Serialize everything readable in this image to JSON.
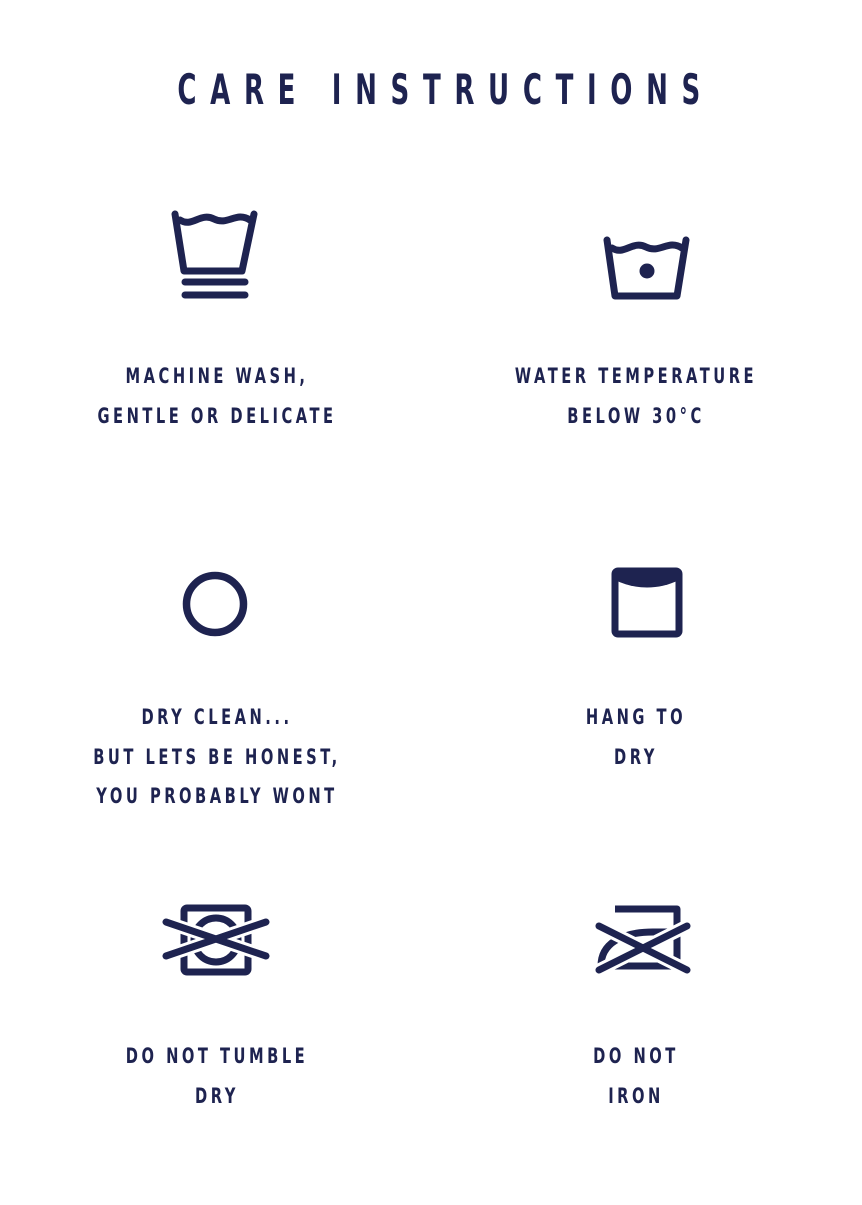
{
  "title": "CARE INSTRUCTIONS",
  "colors": {
    "ink": "#1e2350",
    "background": "#ffffff"
  },
  "items": [
    {
      "icon": "machine-wash-gentle-icon",
      "lines": [
        "MACHINE WASH,",
        "GENTLE OR DELICATE"
      ]
    },
    {
      "icon": "wash-30c-icon",
      "lines": [
        "WATER TEMPERATURE",
        "BELOW 30°C"
      ]
    },
    {
      "icon": "dry-clean-icon",
      "lines": [
        "DRY CLEAN...",
        "BUT LETS BE HONEST,",
        "YOU PROBABLY WONT"
      ]
    },
    {
      "icon": "hang-dry-icon",
      "lines": [
        "HANG TO",
        "DRY"
      ]
    },
    {
      "icon": "do-not-tumble-dry-icon",
      "lines": [
        "DO NOT TUMBLE",
        "DRY"
      ]
    },
    {
      "icon": "do-not-iron-icon",
      "lines": [
        "DO NOT",
        "IRON"
      ]
    }
  ]
}
